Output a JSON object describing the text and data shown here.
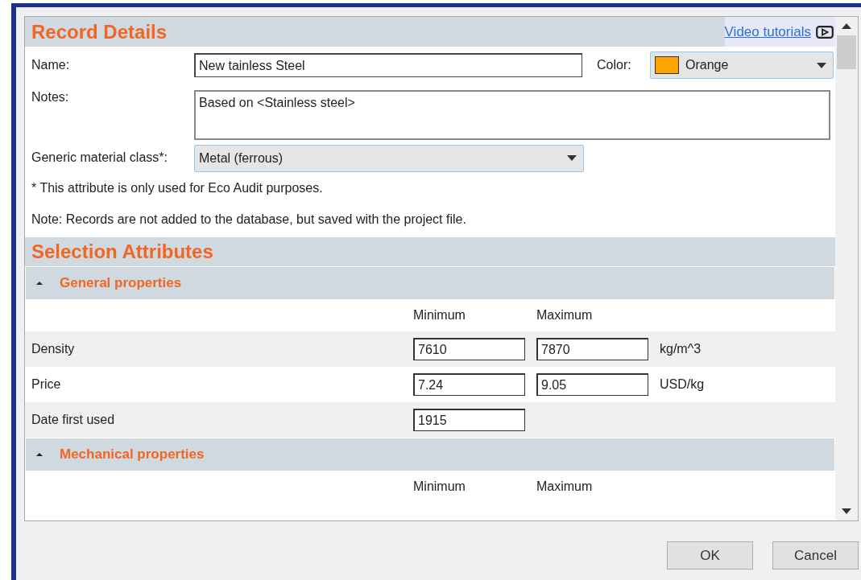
{
  "header": {
    "title": "Record Details",
    "link": "Video tutorials"
  },
  "name": {
    "label": "Name:",
    "value": "New tainless Steel"
  },
  "color": {
    "label": "Color:",
    "value": "Orange",
    "color": "#ffa500"
  },
  "notes": {
    "label": "Notes:",
    "value": "Based on <Stainless steel>"
  },
  "material_class": {
    "label": "Generic material class*:",
    "value": "Metal (ferrous)"
  },
  "footnote": "* This attribute is only used for Eco Audit purposes.",
  "note": "Note: Records are not added to the database, but saved with the project file.",
  "selection": {
    "title": "Selection Attributes",
    "groups": [
      {
        "title": "General properties",
        "expanded": true,
        "columns": [
          "Minimum",
          "Maximum"
        ],
        "rows": [
          {
            "label": "Density",
            "min": "7610",
            "max": "7870",
            "unit": "kg/m^3"
          },
          {
            "label": "Price",
            "min": "7.24",
            "max": "9.05",
            "unit": "USD/kg"
          },
          {
            "label": "Date first used",
            "min": "1915"
          }
        ]
      },
      {
        "title": "Mechanical properties",
        "expanded": true,
        "columns": [
          "Minimum",
          "Maximum"
        ]
      }
    ]
  },
  "buttons": [
    "OK",
    "Cancel"
  ]
}
